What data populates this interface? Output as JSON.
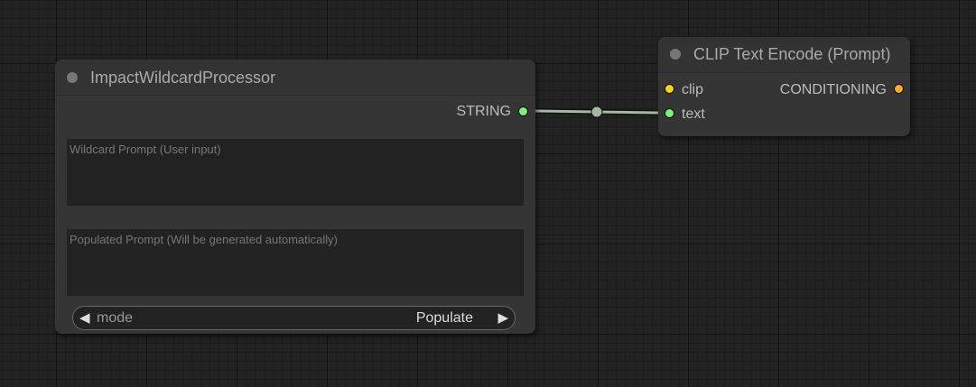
{
  "nodes": {
    "wildcard": {
      "title": "ImpactWildcardProcessor",
      "output_label": "STRING",
      "wildcard_placeholder": "Wildcard Prompt (User input)",
      "populated_placeholder": "Populated Prompt (Will be generated automatically)",
      "mode_label": "mode",
      "mode_value": "Populate"
    },
    "clip": {
      "title": "CLIP Text Encode (Prompt)",
      "input_clip": "clip",
      "input_text": "text",
      "output_label": "CONDITIONING"
    }
  },
  "colors": {
    "string_slot": "#7cf27c",
    "clip_slot": "#f5d515",
    "conditioning_slot": "#ffa931",
    "link": "#a4b8a4"
  },
  "icons": {
    "mode_prev": "left-triangle-icon",
    "mode_next": "right-triangle-icon"
  }
}
